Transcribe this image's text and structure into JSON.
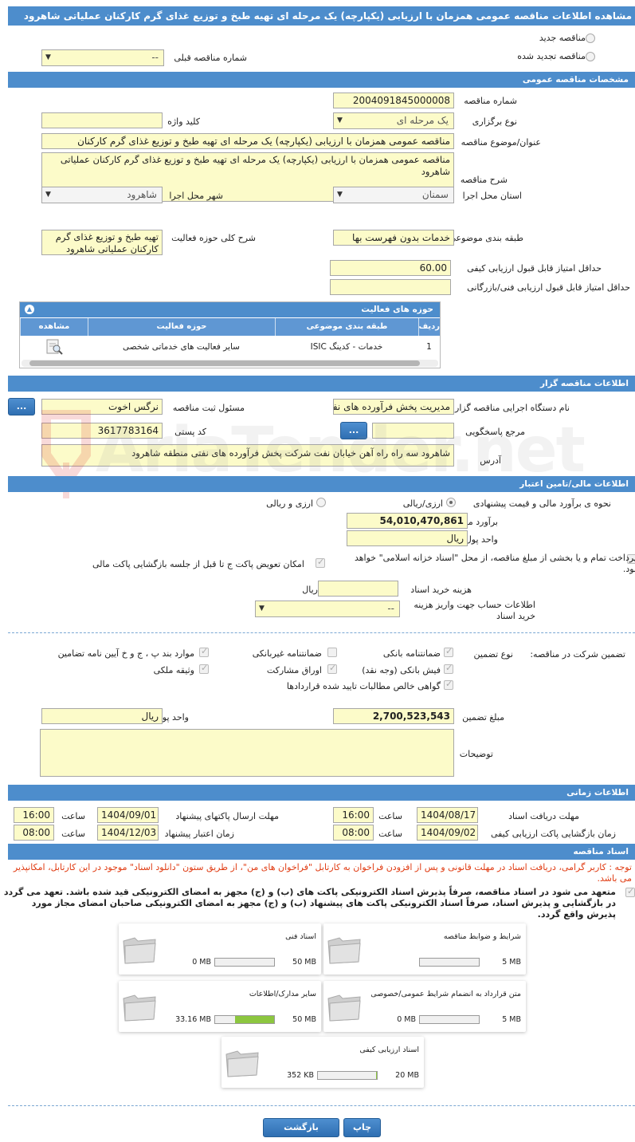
{
  "title": "مشاهده اطلاعات مناقصه عمومی همزمان با ارزیابی (یکپارچه) یک مرحله ای تهیه طبخ و توزیع غذای گرم کارکنان عملیاتی شاهرود",
  "top": {
    "new_tender": "مناقصه جدید",
    "renewed_tender": "مناقصه تجدید شده",
    "previous_number_label": "شماره مناقصه قبلی",
    "previous_number_value": "--"
  },
  "general": {
    "header": "مشخصات مناقصه عمومی",
    "tender_number_label": "شماره مناقصه",
    "tender_number": "2004091845000008",
    "holding_type_label": "نوع برگزاری",
    "holding_type": "یک مرحله ای",
    "keyword_label": "کلید واژه",
    "keyword": "",
    "subject_label": "عنوان/موضوع مناقصه",
    "subject": "مناقصه عمومی همزمان با ارزیابی (یکپارچه) یک مرحله ای تهیه طبخ و توزیع غذای گرم کارکنان",
    "description_label": "شرح مناقصه",
    "description": "مناقصه عمومی همزمان با ارزیابی (یکپارچه) یک مرحله ای تهیه طبخ و توزیع غذای گرم کارکنان عملیاتی شاهرود",
    "province_label": "استان محل اجرا",
    "province": "سمنان",
    "city_label": "شهر محل اجرا",
    "city": "شاهرود",
    "category_label": "طبقه بندی موضوعی",
    "category": "خدمات بدون فهرست بها",
    "scope_label": "شرح کلی حوزه فعالیت",
    "scope": "تهیه طبخ و توزیع غذای گرم کارکنان عملیاتی شاهرود",
    "min_quality_label": "حداقل امتیاز قابل قبول ارزیابی کیفی",
    "min_quality": "60.00",
    "min_technical_label": "حداقل امتیاز قابل قبول ارزیابی فنی/بازرگانی",
    "min_technical": ""
  },
  "activity_grid": {
    "title": "حوزه های فعالیت",
    "columns": [
      "ردیف",
      "طبقه بندی موضوعی",
      "حوزه فعالیت",
      "مشاهده"
    ],
    "rows": [
      {
        "index": "1",
        "category": "خدمات - کدینگ ISIC",
        "activity": "سایر فعالیت های خدماتی شخصی"
      }
    ]
  },
  "organizer": {
    "header": "اطلاعات مناقصه گزار",
    "org_name_label": "نام دستگاه اجرایی مناقصه گزار",
    "org_name": "مدیریت پخش فرآورده های نفتی منطقه شاهرود",
    "registrar_label": "مسئول ثبت مناقصه",
    "registrar": "نرگس اخوت",
    "reference_label": "مرجع پاسخگویی",
    "reference": "",
    "postal_label": "کد پستی",
    "postal": "3617783164",
    "address_label": "آدرس",
    "address": "شاهرود سه راه راه آهن خیابان نفت شرکت  پخش فرآورده های نفتی منطقه شاهرود",
    "dots": "..."
  },
  "finance": {
    "header": "اطلاعات مالی/تامین اعتبار",
    "method_label": "نحوه ی برآورد مالی و قیمت پیشنهادی",
    "opt_currency_rial": "ارزی/ریالی",
    "opt_currency_and_rial": "ارزی و ریالی",
    "estimate_label": "برآورد مالی",
    "estimate": "54,010,470,861",
    "unit_label": "واحد پول",
    "unit": "ریال",
    "islamic_treasury": "پرداخت تمام و یا بخشی از مبلغ مناقصه، از محل \"اسناد خزانه اسلامی\" خواهد بود.",
    "envelope_swap": "امکان تعویض پاکت ج تا قبل از جلسه بازگشایی پاکت مالی",
    "doc_cost_label": "هزینه خرید اسناد",
    "doc_cost": "",
    "doc_cost_unit": "ریال",
    "account_label": "اطلاعات حساب جهت واریز هزینه خرید اسناد",
    "account_value": "--"
  },
  "guarantee": {
    "participation_label": "تضمین شرکت در مناقصه:",
    "type_label": "نوع تضمین",
    "options": {
      "bank_guarantee": "ضمانتنامه بانکی",
      "non_bank_guarantee": "ضمانتنامه غیربانکی",
      "clauses": "موارد بند پ ، ج و خ آیین نامه تضامین",
      "bank_receipt": "فیش بانکی (وجه نقد)",
      "participation_bonds": "اوراق مشارکت",
      "property": "وثیقه ملکی",
      "net_claims": "گواهی خالص مطالبات تایید شده قراردادها"
    },
    "amount_label": "مبلغ تضمین",
    "amount": "2,700,523,543",
    "unit_label": "واحد پول",
    "unit": "ریال",
    "notes_label": "توضیحات",
    "notes": ""
  },
  "timing": {
    "header": "اطلاعات زمانی",
    "receive_docs_label": "مهلت دریافت اسناد",
    "receive_docs_date": "1404/08/17",
    "receive_docs_time": "16:00",
    "send_envelopes_label": "مهلت ارسال پاکتهای پیشنهاد",
    "send_envelopes_date": "1404/09/01",
    "send_envelopes_time": "16:00",
    "open_quality_label": "زمان بازگشایی پاکت ارزیابی کیفی",
    "open_quality_date": "1404/09/02",
    "open_quality_time": "08:00",
    "validity_label": "زمان اعتبار پیشنهاد",
    "validity_date": "1404/12/03",
    "validity_time": "08:00",
    "time_label": "ساعت"
  },
  "documents": {
    "header": "اسناد مناقصه",
    "note": "توجه : کاربر گرامی، دریافت اسناد در مهلت قانونی و پس از افزودن فراخوان به کارتابل \"فراخوان های من\"، از طریق ستون \"دانلود اسناد\" موجود در این کارتابل، امکانپذیر می باشد.",
    "commitment": "متعهد می شود در اسناد مناقصه، صرفاً پذیرش اسناد الکترونیکی پاکت های (ب) و (ج) مجهز به امضای الکترونیکی قید شده باشد. تعهد می گردد در بازگشایی و پذیرش اسناد، صرفاً اسناد الکترونیکی پاکت های پیشنهاد (ب) و (ج) مجهز به امضای الکترونیکی صاحبان امضای مجاز مورد پذیرش واقع گردد.",
    "cards": [
      {
        "name": "شرایط و ضوابط مناقصه",
        "max": "5 MB",
        "current": "",
        "fill": 0
      },
      {
        "name": "اسناد فنی",
        "max": "50 MB",
        "current": "0 MB",
        "fill": 0
      },
      {
        "name": "متن قرارداد به انضمام شرایط عمومی/خصوصی",
        "max": "5 MB",
        "current": "0 MB",
        "fill": 0
      },
      {
        "name": "سایر مدارک/اطلاعات",
        "max": "50 MB",
        "current": "33.16 MB",
        "fill": 0.66
      },
      {
        "name": "اسناد ارزیابی کیفی",
        "max": "20 MB",
        "current": "352 KB",
        "fill": 0.02
      }
    ]
  },
  "buttons": {
    "back": "بازگشت",
    "print": "چاپ"
  },
  "watermark": "AriaTender.net"
}
